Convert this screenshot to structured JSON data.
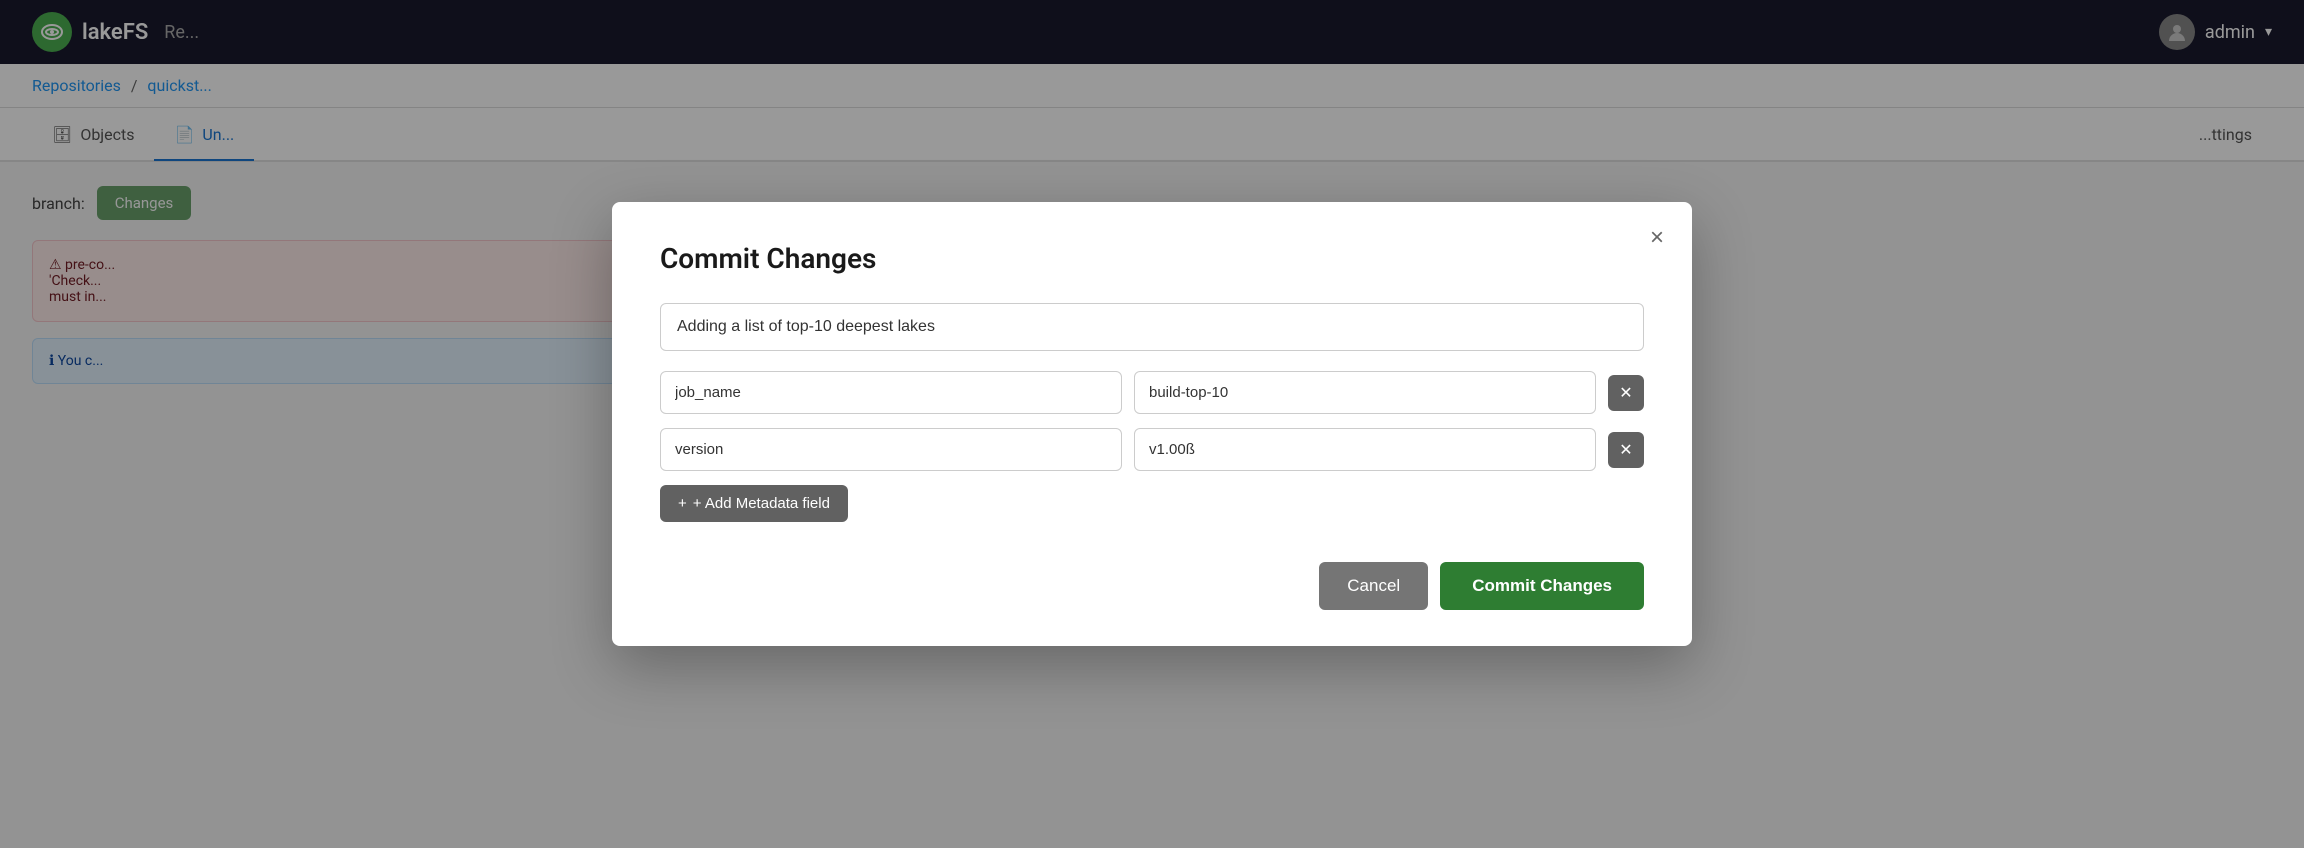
{
  "app": {
    "logo_text": "lakeFS",
    "nav_partial": "Re..."
  },
  "topbar": {
    "user_label": "admin"
  },
  "breadcrumb": {
    "repositories_label": "Repositories",
    "separator": "/",
    "repo_label": "quickst..."
  },
  "tabs": [
    {
      "id": "objects",
      "label": "Objects",
      "icon": "database-icon",
      "active": false
    },
    {
      "id": "uncommitted",
      "label": "Un...",
      "icon": "file-icon",
      "active": true
    },
    {
      "id": "settings",
      "label": "...ttings",
      "icon": "",
      "active": false
    }
  ],
  "main": {
    "branch_label": "branch:",
    "commit_changes_bg_label": "Changes"
  },
  "error_box": {
    "text": "pre-co...\n'Check...\nmust in..."
  },
  "info_box": {
    "text": "You c..."
  },
  "modal": {
    "title": "Commit Changes",
    "close_label": "×",
    "commit_message_placeholder": "",
    "commit_message_value": "Adding a list of top-10 deepest lakes",
    "metadata_rows": [
      {
        "key": "job_name",
        "value": "build-top-10"
      },
      {
        "key": "version",
        "value": "v1.00ß"
      }
    ],
    "add_metadata_label": "+ Add Metadata field",
    "cancel_label": "Cancel",
    "commit_label": "Commit Changes"
  },
  "colors": {
    "topbar_bg": "#1a1a2e",
    "commit_btn_bg": "#2e7d32",
    "cancel_btn_bg": "#757575",
    "remove_btn_bg": "#616161",
    "add_btn_bg": "#616161"
  }
}
